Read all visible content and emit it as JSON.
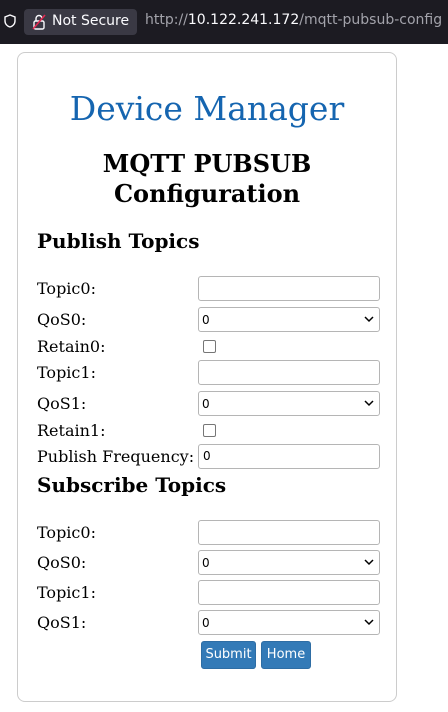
{
  "browser": {
    "security_label": "Not Secure",
    "url_prefix": "http://",
    "url_host": "10.122.241.172",
    "url_path": "/mqtt-pubsub-config"
  },
  "page": {
    "brand": "Device Manager",
    "title_line1": "MQTT PUBSUB",
    "title_line2": "Configuration"
  },
  "publish": {
    "heading": "Publish Topics",
    "topic0_label": "Topic0:",
    "topic0_value": "",
    "qos0_label": "QoS0:",
    "qos0_value": "0",
    "retain0_label": "Retain0:",
    "retain0_checked": false,
    "topic1_label": "Topic1:",
    "topic1_value": "",
    "qos1_label": "QoS1:",
    "qos1_value": "0",
    "retain1_label": "Retain1:",
    "retain1_checked": false,
    "frequency_label": "Publish Frequency:",
    "frequency_value": "0"
  },
  "subscribe": {
    "heading": "Subscribe Topics",
    "topic0_label": "Topic0:",
    "topic0_value": "",
    "qos0_label": "QoS0:",
    "qos0_value": "0",
    "topic1_label": "Topic1:",
    "topic1_value": "",
    "qos1_label": "QoS1:",
    "qos1_value": "0"
  },
  "buttons": {
    "submit": "Submit",
    "home": "Home"
  },
  "colors": {
    "brand": "#1565b0",
    "button": "#337ab7"
  }
}
